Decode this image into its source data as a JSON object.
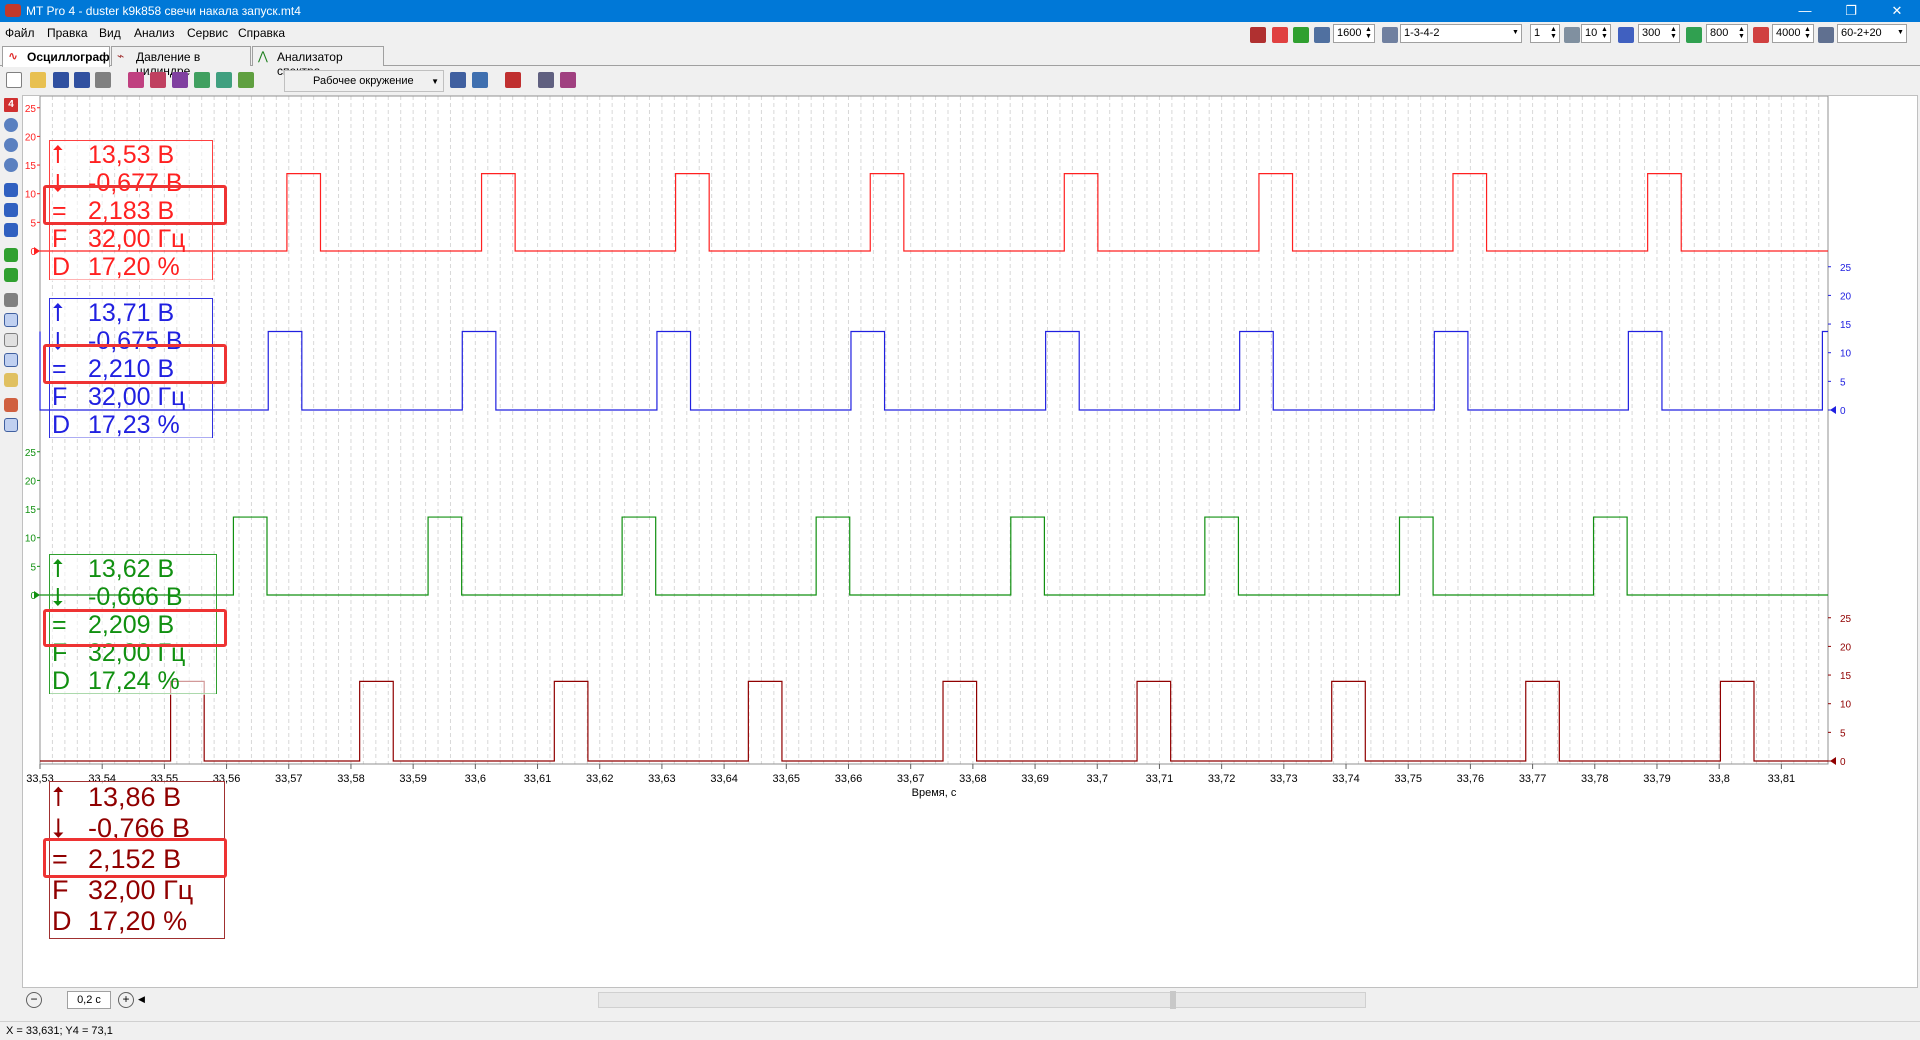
{
  "window": {
    "title": "MT Pro 4 - duster k9k858 свечи накала запуск.mt4"
  },
  "menu": [
    "Файл",
    "Правка",
    "Вид",
    "Анализ",
    "Сервис",
    "Справка"
  ],
  "toolbar_right": {
    "rpm": "1600",
    "firing_order": "1-3-4-2",
    "cyl_count": "1",
    "sync_value": "10",
    "val_300": "300",
    "val_800": "800",
    "val_4000": "4000",
    "wheel": "60-2+20"
  },
  "tabs": [
    "Осциллограф",
    "Давление в цилиндре",
    "Анализатор спектра"
  ],
  "toolbar2": {
    "environment": "Рабочее окружение"
  },
  "left_badge": "4",
  "channels": [
    {
      "name": "ch1",
      "color": "#ff2020",
      "vmax": "13,53 В",
      "vmin": "-0,677 В",
      "vavg": "2,183 В",
      "freq": "32,00 Гц",
      "duty": "17,20 %",
      "freq_sym": "F",
      "duty_sym": "D"
    },
    {
      "name": "ch2",
      "color": "#2020e0",
      "vmax": "13,71 В",
      "vmin": "-0,675 В",
      "vavg": "2,210 В",
      "freq": "32,00 Гц",
      "duty": "17,23 %",
      "freq_sym": "F",
      "duty_sym": "D"
    },
    {
      "name": "ch3",
      "color": "#109010",
      "vmax": "13,62 В",
      "vmin": "-0,666 В",
      "vavg": "2,209 В",
      "freq": "32,00 Гц",
      "duty": "17,24 %",
      "freq_sym": "F",
      "duty_sym": "D"
    },
    {
      "name": "ch4",
      "color": "#900000",
      "vmax": "13,86 В",
      "vmin": "-0,766 В",
      "vavg": "2,152 В",
      "freq": "32,00 Гц",
      "duty": "17,20 %",
      "freq_sym": "F",
      "duty_sym": "D"
    }
  ],
  "chart_data": {
    "type": "line",
    "xlabel": "Время, с",
    "x_ticks": [
      "33,53",
      "33,54",
      "33,55",
      "33,56",
      "33,57",
      "33,58",
      "33,59",
      "33,6",
      "33,61",
      "33,62",
      "33,63",
      "33,64",
      "33,65",
      "33,66",
      "33,67",
      "33,68",
      "33,69",
      "33,7",
      "33,71",
      "33,72",
      "33,73",
      "33,74",
      "33,75",
      "33,76",
      "33,77",
      "33,78",
      "33,79",
      "33,8",
      "33,81"
    ],
    "y_ticks": [
      "0",
      "5",
      "10",
      "15",
      "20",
      "25"
    ],
    "y_range": [
      0,
      25
    ],
    "series": [
      {
        "color": "#ff2020",
        "low": 0,
        "high": 13.5,
        "pulse_starts": [
          33.5697,
          33.601,
          33.6322,
          33.6635,
          33.6947,
          33.726,
          33.7572,
          33.7885
        ],
        "pulse_width": 0.0054
      },
      {
        "color": "#2020e0",
        "low": 0,
        "high": 13.7,
        "pulse_starts": [
          33.5225,
          33.5667,
          33.5979,
          33.6292,
          33.6604,
          33.6917,
          33.7229,
          33.7542,
          33.7854,
          33.8166
        ],
        "pulse_width": 0.0054
      },
      {
        "color": "#109010",
        "low": 0,
        "high": 13.6,
        "pulse_starts": [
          33.5611,
          33.5924,
          33.6236,
          33.6548,
          33.6861,
          33.7173,
          33.7486,
          33.7798
        ],
        "pulse_width": 0.0054
      },
      {
        "color": "#900000",
        "low": 0,
        "high": 13.9,
        "pulse_starts": [
          33.551,
          33.5814,
          33.6127,
          33.6439,
          33.6752,
          33.7064,
          33.7377,
          33.7689,
          33.8002
        ],
        "pulse_width": 0.0054
      }
    ]
  },
  "timebase": "0,2 с",
  "status": "X = 33,631; Y4 = 73,1"
}
